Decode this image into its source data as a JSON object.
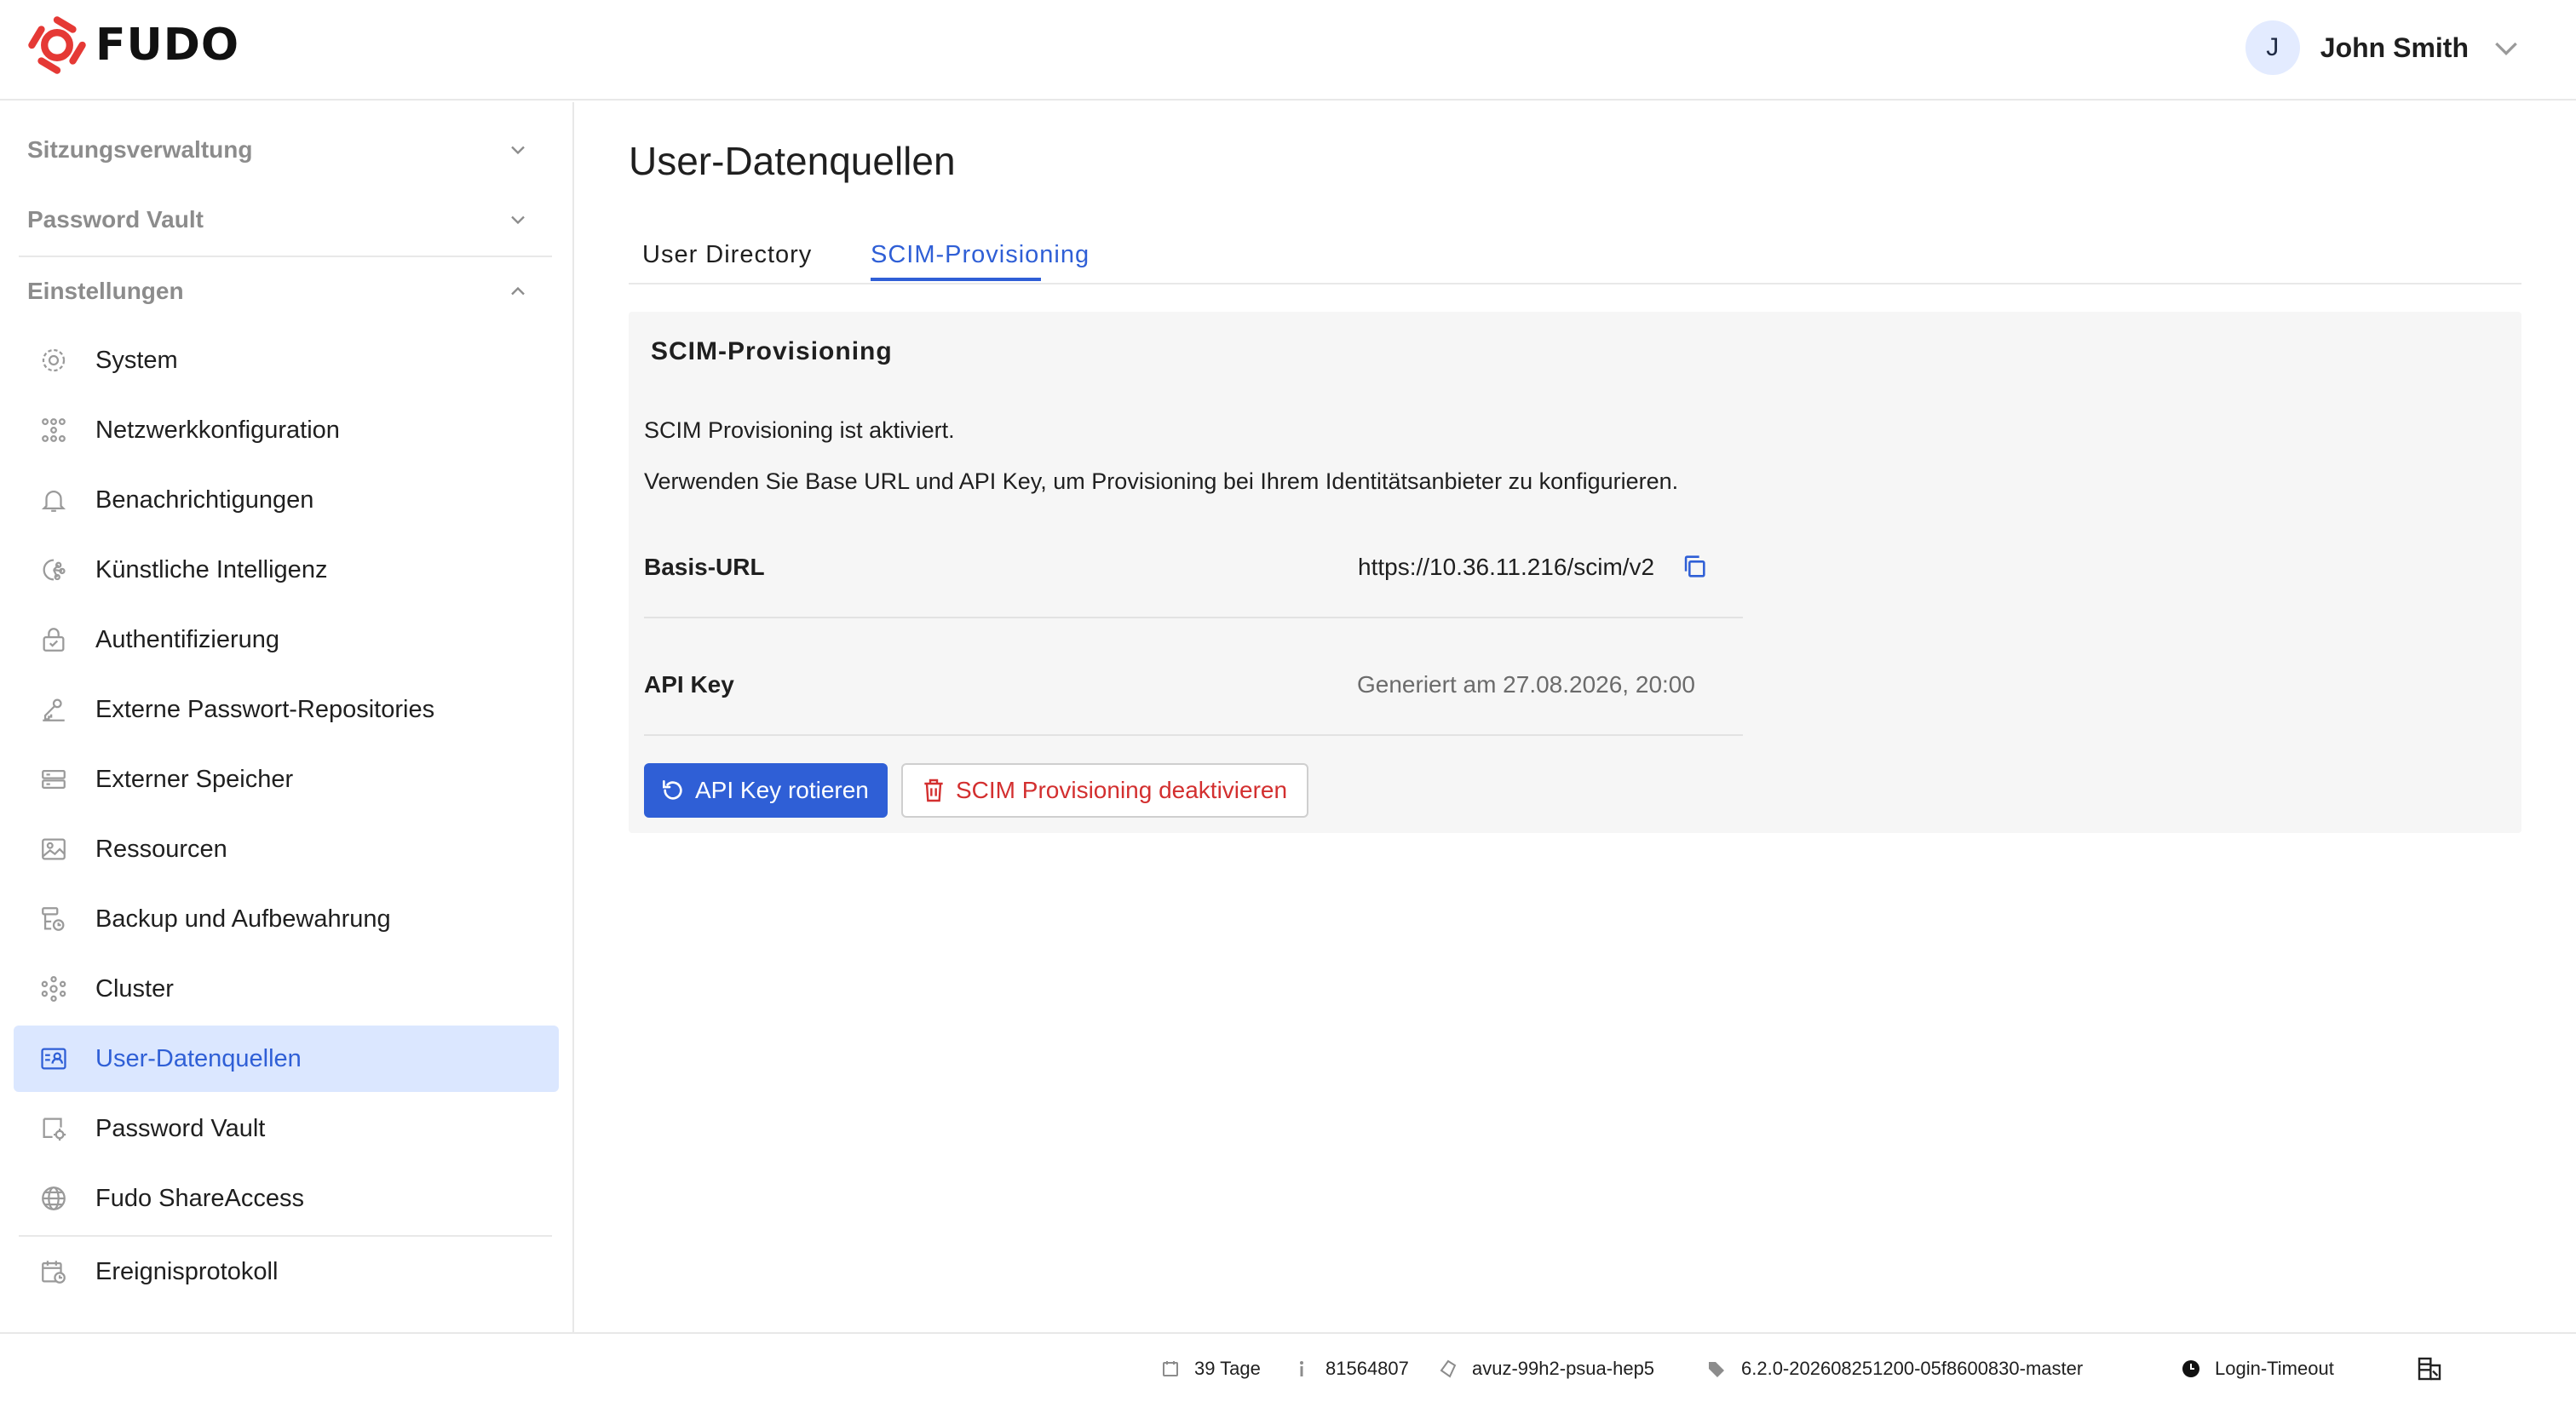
{
  "app": {
    "brand": "FUDO"
  },
  "header": {
    "user_initial": "J",
    "user_name": "John Smith"
  },
  "sidebar": {
    "sections": [
      {
        "label": "Sitzungsverwaltung",
        "expanded": false
      },
      {
        "label": "Password Vault",
        "expanded": false
      },
      {
        "label": "Einstellungen",
        "expanded": true
      }
    ],
    "items": [
      {
        "label": "System",
        "icon": "gear-icon"
      },
      {
        "label": "Netzwerkkonfiguration",
        "icon": "network-icon"
      },
      {
        "label": "Benachrichtigungen",
        "icon": "bell-icon"
      },
      {
        "label": "Künstliche Intelligenz",
        "icon": "ai-icon"
      },
      {
        "label": "Authentifizierung",
        "icon": "lock-icon"
      },
      {
        "label": "Externe Passwort-Repositories",
        "icon": "key-icon"
      },
      {
        "label": "Externer Speicher",
        "icon": "storage-icon"
      },
      {
        "label": "Ressourcen",
        "icon": "image-icon"
      },
      {
        "label": "Backup und Aufbewahrung",
        "icon": "backup-icon"
      },
      {
        "label": "Cluster",
        "icon": "cluster-icon"
      },
      {
        "label": "User-Datenquellen",
        "icon": "user-card-icon",
        "active": true
      },
      {
        "label": "Password Vault",
        "icon": "vault-icon"
      },
      {
        "label": "Fudo ShareAccess",
        "icon": "globe-icon"
      },
      {
        "label": "Ereignisprotokoll",
        "icon": "calendar-icon"
      }
    ]
  },
  "main": {
    "title": "User-Datenquellen",
    "tabs": [
      {
        "label": "User Directory",
        "active": false
      },
      {
        "label": "SCIM-Provisioning",
        "active": true
      }
    ],
    "panel": {
      "title": "SCIM-Provisioning",
      "status_text": "SCIM Provisioning ist aktiviert.",
      "help_text": "Verwenden Sie Base URL und API Key, um Provisioning bei Ihrem Identitätsanbieter zu konfigurieren.",
      "base_url_label": "Basis-URL",
      "base_url_value": "https://10.36.11.216/scim/v2",
      "api_key_label": "API Key",
      "api_key_value": "Generiert am 27.08.2026, 20:00",
      "rotate_button": "API Key rotieren",
      "deactivate_button": "SCIM Provisioning deaktivieren"
    }
  },
  "footer": {
    "days": "39 Tage",
    "id": "81564807",
    "node": "avuz-99h2-psua-hep5",
    "version": "6.2.0-202608251200-05f8600830-master",
    "timeout": "Login-Timeout"
  },
  "colors": {
    "accent": "#2f5fd6",
    "danger": "#d32f2f",
    "brand_red": "#e53935"
  }
}
